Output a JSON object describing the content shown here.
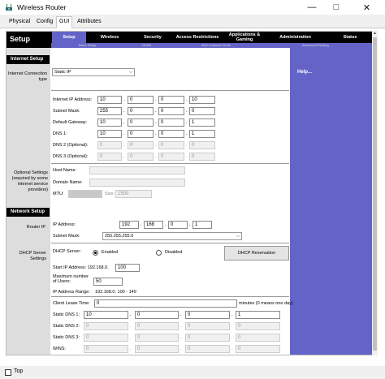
{
  "window": {
    "title": "Wireless Router",
    "minimize_icon": "minimize-icon",
    "maximize_icon": "maximize-icon",
    "close_icon": "close-icon"
  },
  "tabs": [
    {
      "label": "Physical"
    },
    {
      "label": "Config"
    },
    {
      "label": "GUI",
      "active": true
    },
    {
      "label": "Attributes"
    }
  ],
  "header": {
    "title": "Setup",
    "nav": [
      {
        "label": "Setup",
        "active": true
      },
      {
        "label": "Wireless"
      },
      {
        "label": "Security"
      },
      {
        "label": "Access Restrictions"
      },
      {
        "label": "Applications & Gaming"
      },
      {
        "label": "Administration"
      },
      {
        "label": "Status"
      }
    ],
    "subnav": [
      {
        "label": "Basic Setup"
      },
      {
        "label": "DDNS"
      },
      {
        "label": "MAC Address Clone"
      },
      {
        "label": "Advanced Routing"
      }
    ]
  },
  "help": {
    "label": "Help..."
  },
  "internet": {
    "section_title": "Internet Setup",
    "connection_type_label": "Internet Connection type",
    "connection_type_value": "Static IP",
    "ip_label": "Internet IP Address:",
    "ip": [
      "10",
      "0",
      "0",
      "10"
    ],
    "mask_label": "Subnet Mask:",
    "mask": [
      "255",
      "0",
      "0",
      "0"
    ],
    "gw_label": "Default Gateway:",
    "gw": [
      "10",
      "0",
      "0",
      "1"
    ],
    "dns1_label": "DNS 1:",
    "dns1": [
      "10",
      "0",
      "0",
      "1"
    ],
    "dns2_label": "DNS 2 (Optional):",
    "dns2": [
      "0",
      "0",
      "0",
      "0"
    ],
    "dns3_label": "DNS 3 (Optional):",
    "dns3": [
      "0",
      "0",
      "0",
      "0"
    ],
    "optional_label": "Optional Settings (required by some internet service providers)",
    "host_label": "Host Name:",
    "domain_label": "Domain Name:",
    "mtu_label": "MTU:",
    "size_label": "Size:",
    "size_value": "1500"
  },
  "network": {
    "section_title": "Network Setup",
    "router_ip_label": "Router IP",
    "ip_label": "IP Address:",
    "ip": [
      "192",
      "168",
      "0",
      "1"
    ],
    "mask_label": "Subnet Mask:",
    "mask_value": "255.255.255.0",
    "dhcp_label": "DHCP Server Settings",
    "dhcp_server_label": "DHCP Server:",
    "enabled_label": "Enabled",
    "disabled_label": "Disabled",
    "reservation_label": "DHCP Reservation",
    "start_ip_label": "Start IP Address: 192.168.0.",
    "start_ip_value": "100",
    "max_users_label": "Maximum number of Users:",
    "max_users_value": "50",
    "ip_range_label": "IP Address Range:",
    "ip_range_value": "192.168.0. 100 - 149",
    "lease_label": "Client Lease Time:",
    "lease_value": "0",
    "lease_suffix": "minutes (0 means one day)",
    "sdns1_label": "Static DNS 1:",
    "sdns1": [
      "10",
      "0",
      "0",
      "1"
    ],
    "sdns2_label": "Static DNS 2:",
    "sdns2": [
      "0",
      "0",
      "0",
      "0"
    ],
    "sdns3_label": "Static DNS 3:",
    "sdns3": [
      "0",
      "0",
      "0",
      "0"
    ],
    "wins_label": "WINS:",
    "wins": [
      "0",
      "0",
      "0",
      "0"
    ]
  },
  "bottom": {
    "top_label": "Top"
  },
  "colors": {
    "accent": "#6464c8",
    "header": "#000000"
  }
}
